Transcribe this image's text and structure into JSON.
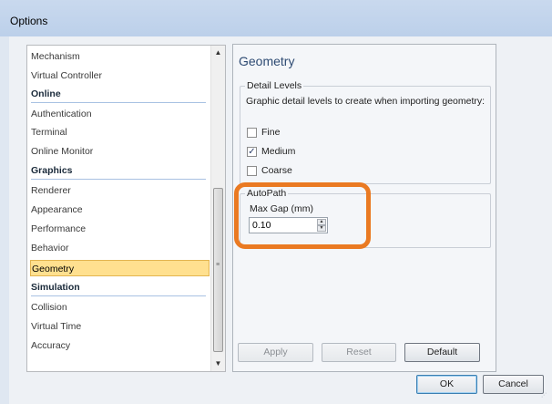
{
  "window": {
    "title": "Options"
  },
  "nav": {
    "items": [
      {
        "label": "Mechanism",
        "kind": "item"
      },
      {
        "label": "Virtual Controller",
        "kind": "item"
      },
      {
        "label": "Online",
        "kind": "header"
      },
      {
        "label": "Authentication",
        "kind": "item"
      },
      {
        "label": "Terminal",
        "kind": "item"
      },
      {
        "label": "Online Monitor",
        "kind": "item"
      },
      {
        "label": "Graphics",
        "kind": "header"
      },
      {
        "label": "Renderer",
        "kind": "item"
      },
      {
        "label": "Appearance",
        "kind": "item"
      },
      {
        "label": "Performance",
        "kind": "item"
      },
      {
        "label": "Behavior",
        "kind": "item"
      },
      {
        "label": "Geometry",
        "kind": "item",
        "selected": true
      },
      {
        "label": "Simulation",
        "kind": "header"
      },
      {
        "label": "Collision",
        "kind": "item"
      },
      {
        "label": "Virtual Time",
        "kind": "item"
      },
      {
        "label": "Accuracy",
        "kind": "item"
      }
    ],
    "scroll_up": "▲",
    "scroll_down": "▼"
  },
  "panel": {
    "title": "Geometry",
    "detail_levels": {
      "group_label": "Detail Levels",
      "description": "Graphic detail levels to create when importing geometry:",
      "options": [
        {
          "label": "Fine",
          "checked": false
        },
        {
          "label": "Medium",
          "checked": true
        },
        {
          "label": "Coarse",
          "checked": false
        }
      ]
    },
    "autopath": {
      "group_label": "AutoPath",
      "field_label": "Max Gap (mm)",
      "value": "0.10"
    },
    "buttons": {
      "apply": "Apply",
      "reset": "Reset",
      "default": "Default"
    }
  },
  "footer": {
    "ok": "OK",
    "cancel": "Cancel"
  },
  "colors": {
    "highlight": "#ea7a22",
    "selected": "#ffe08f",
    "title_accent": "#2e4b73"
  }
}
